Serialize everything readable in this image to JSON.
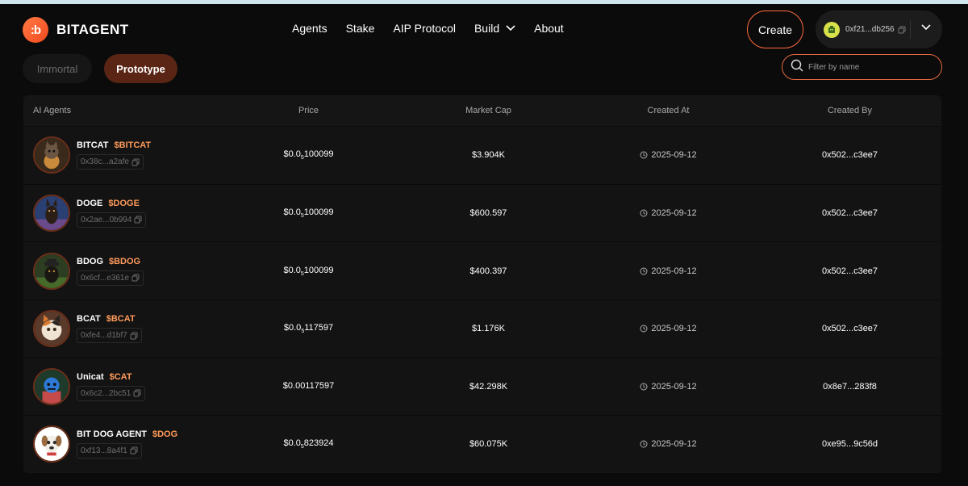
{
  "brand": {
    "logo_glyph": ":b",
    "name": "BITAGENT",
    "accent": "#f24a1d"
  },
  "nav": {
    "items": [
      {
        "label": "Agents"
      },
      {
        "label": "Stake"
      },
      {
        "label": "AIP Protocol"
      },
      {
        "label": "Build"
      },
      {
        "label": "About"
      }
    ]
  },
  "header": {
    "create_label": "Create",
    "wallet_address": "0xf21...db256"
  },
  "tabs": [
    {
      "label": "Immortal",
      "active": false
    },
    {
      "label": "Prototype",
      "active": true
    }
  ],
  "filter": {
    "placeholder": "Filter by name"
  },
  "table": {
    "columns": [
      "AI Agents",
      "Price",
      "Market Cap",
      "Created At",
      "Created By"
    ],
    "rows": [
      {
        "name": "BITCAT",
        "ticker": "$BITCAT",
        "address": "0x38c...a2afe",
        "price_prefix": "$0.0",
        "price_sub": "5",
        "price_digits": "100099",
        "market_cap": "$3.904K",
        "created_at": "2025-09-12",
        "created_by": "0x502...c3ee7",
        "avatar_icon": "cat-avatar-icon"
      },
      {
        "name": "DOGE",
        "ticker": "$DOGE",
        "address": "0x2ae...0b994",
        "price_prefix": "$0.0",
        "price_sub": "5",
        "price_digits": "100099",
        "market_cap": "$600.597",
        "created_at": "2025-09-12",
        "created_by": "0x502...c3ee7",
        "avatar_icon": "doge-avatar-icon"
      },
      {
        "name": "BDOG",
        "ticker": "$BDOG",
        "address": "0x6cf...e361e",
        "price_prefix": "$0.0",
        "price_sub": "5",
        "price_digits": "100099",
        "market_cap": "$400.397",
        "created_at": "2025-09-12",
        "created_by": "0x502...c3ee7",
        "avatar_icon": "bdog-avatar-icon"
      },
      {
        "name": "BCAT",
        "ticker": "$BCAT",
        "address": "0xfe4...d1bf7",
        "price_prefix": "$0.0",
        "price_sub": "5",
        "price_digits": "117597",
        "market_cap": "$1.176K",
        "created_at": "2025-09-12",
        "created_by": "0x502...c3ee7",
        "avatar_icon": "bcat-avatar-icon"
      },
      {
        "name": "Unicat",
        "ticker": "$CAT",
        "address": "0x6c2...2bc51",
        "price_prefix": "$0.00117597",
        "price_sub": "",
        "price_digits": "",
        "market_cap": "$42.298K",
        "created_at": "2025-09-12",
        "created_by": "0x8e7...283f8",
        "avatar_icon": "unicat-avatar-icon"
      },
      {
        "name": "BIT DOG AGENT",
        "ticker": "$DOG",
        "address": "0xf13...8a4f1",
        "price_prefix": "$0.0",
        "price_sub": "5",
        "price_digits": "823924",
        "market_cap": "$60.075K",
        "created_at": "2025-09-12",
        "created_by": "0xe95...9c56d",
        "avatar_icon": "bitdog-avatar-icon"
      }
    ]
  }
}
